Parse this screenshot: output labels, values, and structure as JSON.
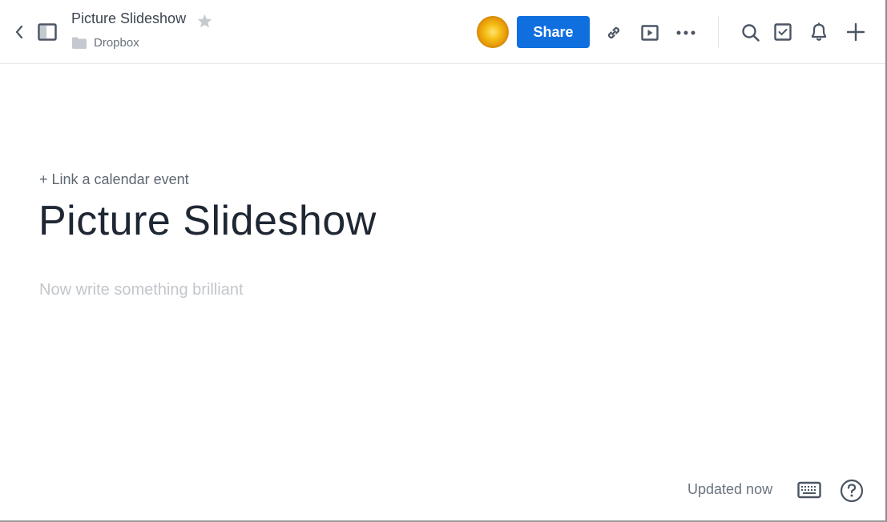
{
  "header": {
    "back_icon": "chevron-left-icon",
    "sidebar_toggle_icon": "sidebar-toggle-icon",
    "document_title": "Picture Slideshow",
    "star_icon": "star-icon",
    "folder_icon": "folder-icon",
    "folder_name": "Dropbox",
    "avatar_icon": "user-avatar",
    "share_label": "Share",
    "actions": [
      "link-icon",
      "present-icon",
      "more-icon"
    ],
    "global": [
      "search-icon",
      "tasks-icon",
      "bell-icon",
      "plus-icon"
    ],
    "accent_color": "#0f6fdf"
  },
  "document": {
    "calendar_link": "+ Link a calendar event",
    "title": "Picture Slideshow",
    "body_placeholder": "Now write something brilliant"
  },
  "footer": {
    "status": "Updated now",
    "keyboard_icon": "keyboard-icon",
    "help_icon": "help-icon"
  }
}
